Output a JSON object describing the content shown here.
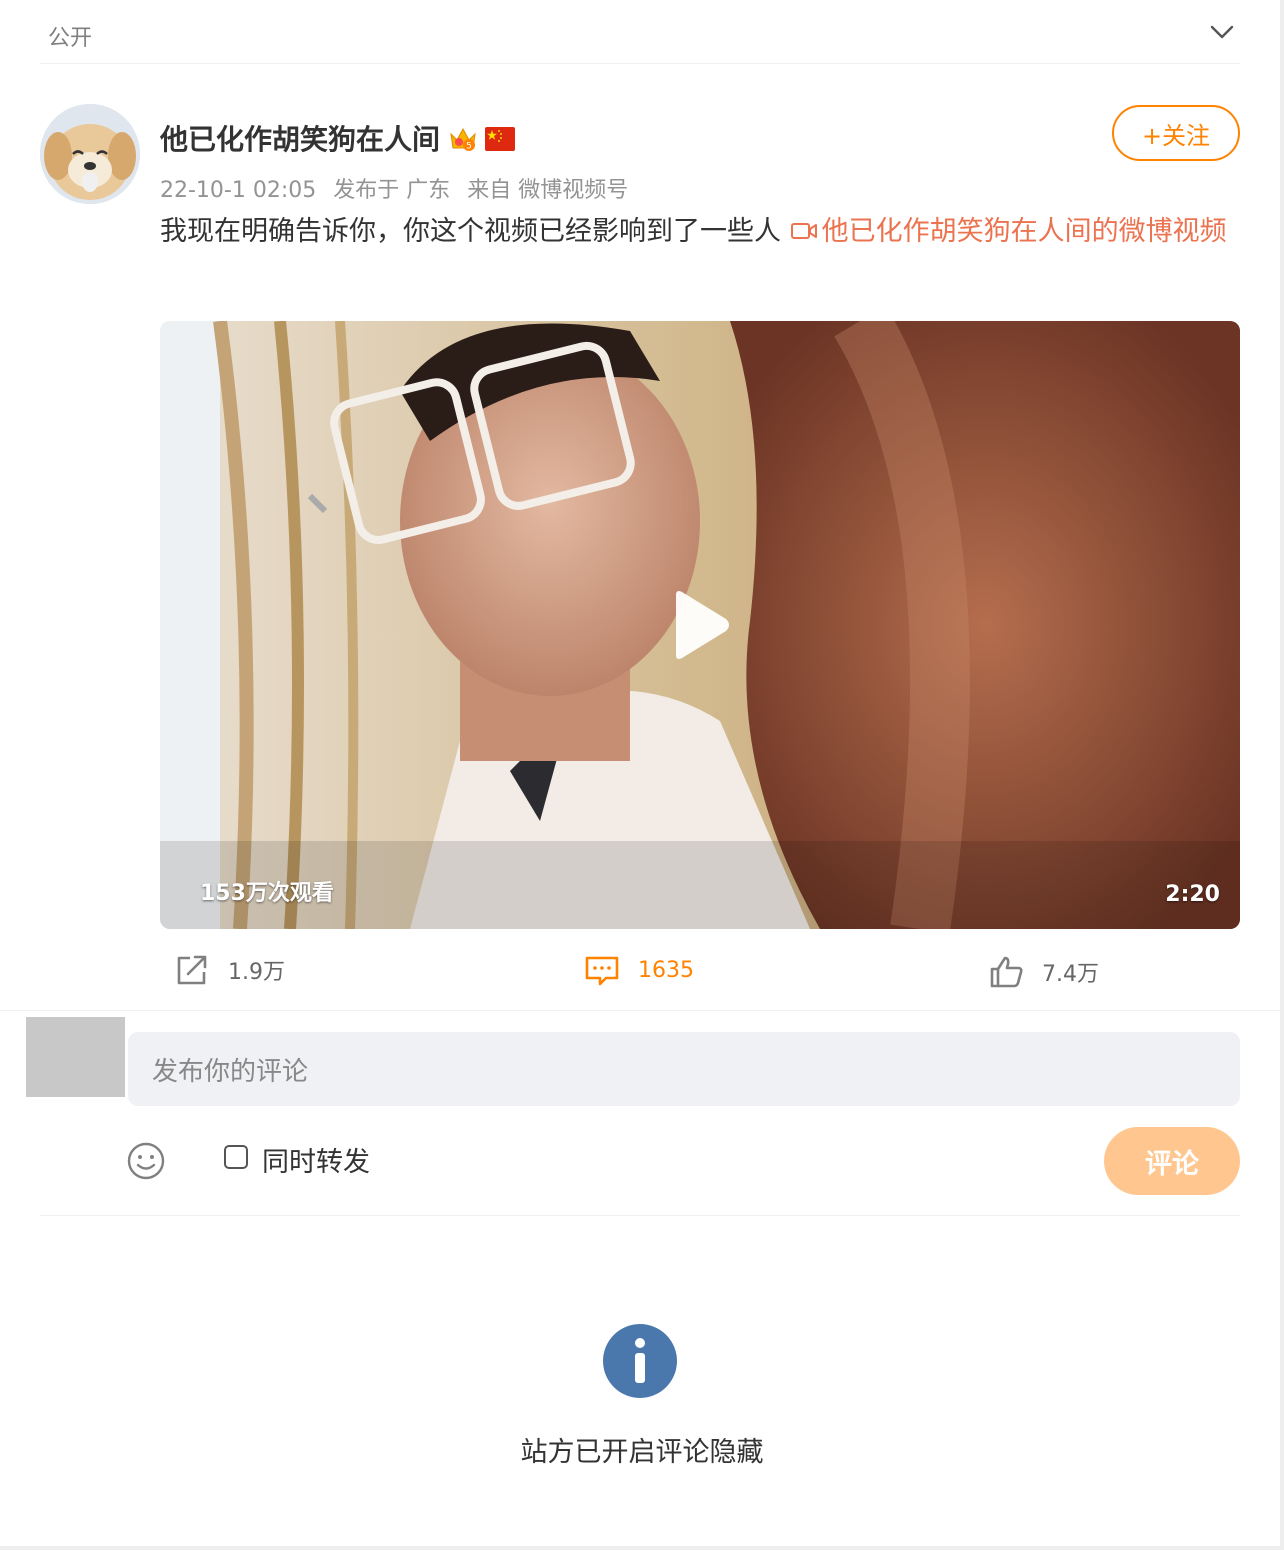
{
  "header": {
    "visibility": "公开",
    "collapse_icon": "chevron-down-icon"
  },
  "post": {
    "author": "他已化作胡笑狗在人间",
    "badges": [
      "crown-icon",
      "china-flag-icon"
    ],
    "follow_label": "+关注",
    "time": "22-10-1 02:05",
    "published_in": "发布于 广东",
    "source": "来自 微博视频号",
    "text": "我现在明确告诉你，你这个视频已经影响到了一些人",
    "link_text": "他已化作胡笑狗在人间的微博视频",
    "video": {
      "views": "153万次观看",
      "duration": "2:20"
    }
  },
  "actions": {
    "reposts": "1.9万",
    "comments": "1635",
    "likes": "7.4万"
  },
  "comment_box": {
    "placeholder": "发布你的评论",
    "repost_label": "同时转发",
    "submit_label": "评论"
  },
  "notice": "站方已开启评论隐藏",
  "colors": {
    "accent": "#ff8200",
    "link": "#eb7350",
    "info": "#4a78ad"
  }
}
